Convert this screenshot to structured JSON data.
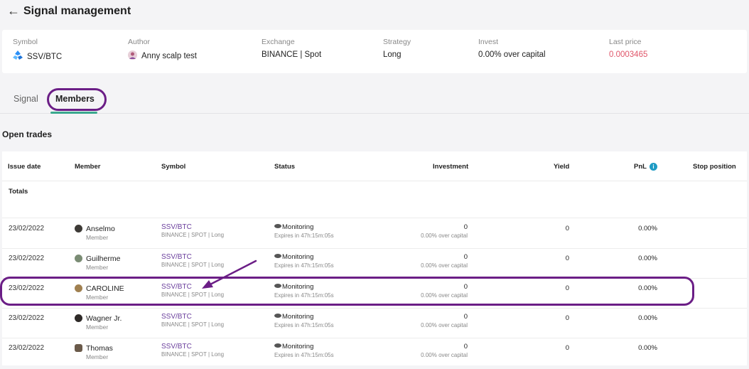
{
  "header": {
    "back_icon": "arrow-left-icon",
    "title": "Signal management"
  },
  "info": {
    "symbol": {
      "label": "Symbol",
      "value": "SSV/BTC",
      "icon": "ssv-coin-icon"
    },
    "author": {
      "label": "Author",
      "value": "Anny scalp test",
      "icon": "avatar-icon"
    },
    "exchange": {
      "label": "Exchange",
      "value": "BINANCE | Spot"
    },
    "strategy": {
      "label": "Strategy",
      "value": "Long"
    },
    "invest": {
      "label": "Invest",
      "value": "0.00% over capital"
    },
    "last_price": {
      "label": "Last price",
      "value": "0.0003465",
      "color": "#e0566a"
    }
  },
  "tabs": [
    {
      "label": "Signal",
      "active": false
    },
    {
      "label": "Members",
      "active": true
    }
  ],
  "section_title": "Open trades",
  "table": {
    "columns": {
      "issue_date": "Issue date",
      "member": "Member",
      "symbol": "Symbol",
      "status": "Status",
      "investment": "Investment",
      "yield": "Yield",
      "pnl": "PnL",
      "stop_position": "Stop position"
    },
    "totals_label": "Totals",
    "rows": [
      {
        "date": "23/02/2022",
        "name": "Anselmo",
        "role": "Member",
        "symbol": "SSV/BTC",
        "symbol_sub": "BINANCE | SPOT | Long",
        "status": "Monitoring",
        "expires": "Expires in 47h:15m:05s",
        "investment": "0",
        "investment_sub": "0.00% over capital",
        "yield": "0",
        "pnl": "0.00%"
      },
      {
        "date": "23/02/2022",
        "name": "Guilherme",
        "role": "Member",
        "symbol": "SSV/BTC",
        "symbol_sub": "BINANCE | SPOT | Long",
        "status": "Monitoring",
        "expires": "Expires in 47h:15m:05s",
        "investment": "0",
        "investment_sub": "0.00% over capital",
        "yield": "0",
        "pnl": "0.00%"
      },
      {
        "date": "23/02/2022",
        "name": "CAROLINE",
        "role": "Member",
        "symbol": "SSV/BTC",
        "symbol_sub": "BINANCE | SPOT | Long",
        "status": "Monitoring",
        "expires": "Expires in 47h:15m:05s",
        "investment": "0",
        "investment_sub": "0.00% over capital",
        "yield": "0",
        "pnl": "0.00%"
      },
      {
        "date": "23/02/2022",
        "name": "Wagner Jr.",
        "role": "Member",
        "symbol": "SSV/BTC",
        "symbol_sub": "BINANCE | SPOT | Long",
        "status": "Monitoring",
        "expires": "Expires in 47h:15m:05s",
        "investment": "0",
        "investment_sub": "0.00% over capital",
        "yield": "0",
        "pnl": "0.00%"
      },
      {
        "date": "23/02/2022",
        "name": "Thomas",
        "role": "Member",
        "symbol": "SSV/BTC",
        "symbol_sub": "BINANCE | SPOT | Long",
        "status": "Monitoring",
        "expires": "Expires in 47h:15m:05s",
        "investment": "0",
        "investment_sub": "0.00% over capital",
        "yield": "0",
        "pnl": "0.00%"
      }
    ]
  },
  "colors": {
    "accent_tab": "#3aa88e",
    "link": "#6a3e9c",
    "annotation": "#6b1e86",
    "info_icon": "#1e9bc4"
  }
}
